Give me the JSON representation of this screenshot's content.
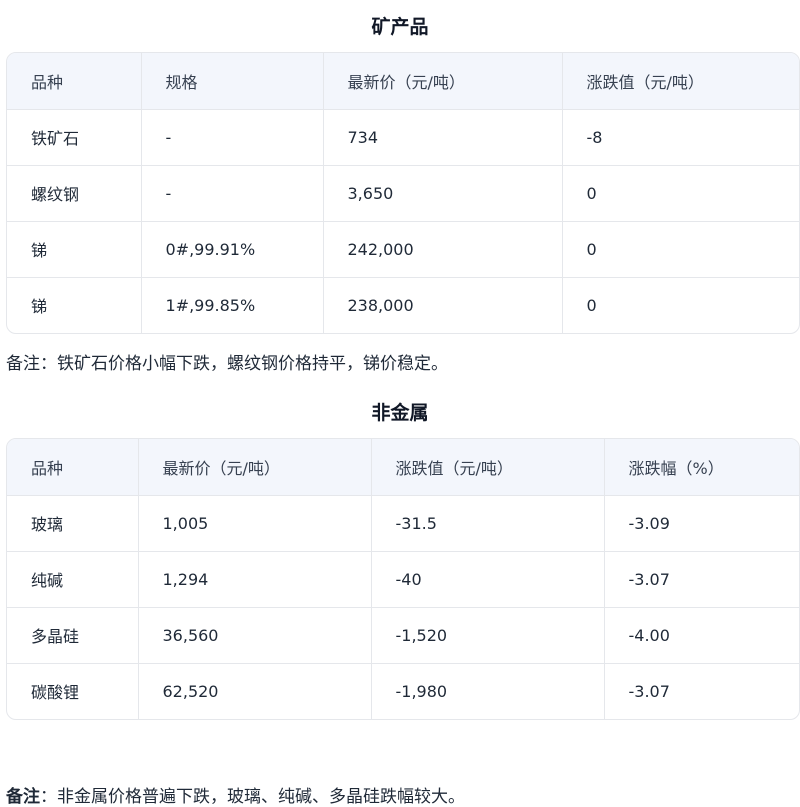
{
  "minerals": {
    "title": "矿产品",
    "headers": [
      "品种",
      "规格",
      "最新价（元/吨）",
      "涨跌值（元/吨）"
    ],
    "rows": [
      [
        "铁矿石",
        "-",
        "734",
        "-8"
      ],
      [
        "螺纹钢",
        "-",
        "3,650",
        "0"
      ],
      [
        "锑",
        "0#,99.91%",
        "242,000",
        "0"
      ],
      [
        "锑",
        "1#,99.85%",
        "238,000",
        "0"
      ]
    ],
    "note": "备注：铁矿石价格小幅下跌，螺纹钢价格持平，锑价稳定。"
  },
  "nonmetals": {
    "title": "非金属",
    "headers": [
      "品种",
      "最新价（元/吨）",
      "涨跌值（元/吨）",
      "涨跌幅（%）"
    ],
    "rows": [
      [
        "玻璃",
        "1,005",
        "-31.5",
        "-3.09"
      ],
      [
        "纯碱",
        "1,294",
        "-40",
        "-3.07"
      ],
      [
        "多晶硅",
        "36,560",
        "-1,520",
        "-4.00"
      ],
      [
        "碳酸锂",
        "62,520",
        "-1,980",
        "-3.07"
      ]
    ],
    "note_label": "备注",
    "note_text": "：非金属价格普遍下跌，玻璃、纯碱、多晶硅跌幅较大。"
  }
}
